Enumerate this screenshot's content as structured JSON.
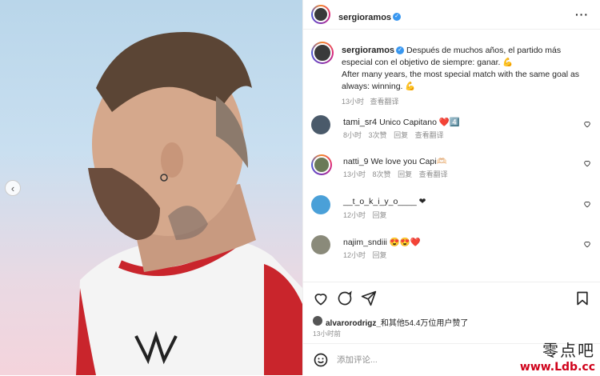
{
  "post": {
    "username": "sergioramos",
    "more_icon": "ellipsis-icon"
  },
  "caption": {
    "username": "sergioramos",
    "text_es": "Después de muchos años, el partido más especial con el objetivo de siempre: ganar. 💪",
    "text_en": "After many years, the most special match with the same goal as always: winning. 💪",
    "time": "13小时",
    "translate": "查看翻译"
  },
  "comments": [
    {
      "username": "tami_sr4",
      "text": "Unico Capitano ❤️4️⃣",
      "time": "8小时",
      "likes": "3次赞",
      "reply": "回复",
      "translate": "查看翻译"
    },
    {
      "username": "natti_9",
      "text": "We love you Capi🫶🏻",
      "time": "13小时",
      "likes": "8次赞",
      "reply": "回复",
      "translate": "查看翻译"
    },
    {
      "username": "__t_o_k_i_y_o____",
      "text": "❤",
      "time": "12小时",
      "reply": "回复"
    },
    {
      "username": "najim_sndiii",
      "text": "😍😍❤️",
      "time": "12小时",
      "reply": "回复"
    }
  ],
  "actions": {
    "liked_by_user": "alvarorodrigz_",
    "liked_by_rest": "和其他54.4万位用户赞了",
    "timestamp": "13小时前",
    "comment_placeholder": "添加评论..."
  },
  "watermark": {
    "line1": "零点吧",
    "line2": "www.Ldb.cc"
  },
  "colors": {
    "verified": "#3897f0",
    "ring_start": "#f58529",
    "ring_end": "#515bd4"
  }
}
